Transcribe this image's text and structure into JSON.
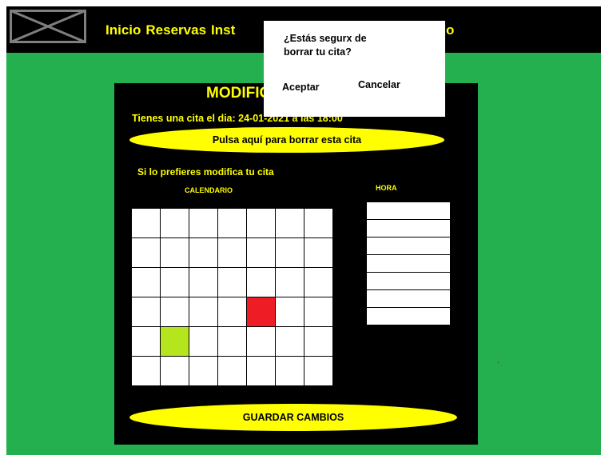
{
  "colors": {
    "background": "#24b04e",
    "bar": "#000000",
    "accent": "#ffff00",
    "selected_day": "#ee1c24",
    "highlighted_day": "#b5e61d"
  },
  "nav": {
    "items": [
      "Inicio",
      "Reservas",
      "Inst"
    ],
    "trailing": "o"
  },
  "logo": {
    "icon": "image-placeholder-icon"
  },
  "panel": {
    "title": "MODIFIC",
    "appointment_text": "Tienes una cita  el dia: 24-01-2021 a las 18:00",
    "delete_button": "Pulsa aquí para borrar esta cita",
    "prefer_text": "Si lo prefieres modifica tu cita",
    "calendar_label": "CALENDARIO",
    "hour_label": "HORA",
    "save_button": "GUARDAR CAMBIOS"
  },
  "calendar": {
    "rows": 6,
    "cols": 7,
    "red_cell": [
      3,
      4
    ],
    "green_cell": [
      4,
      1
    ]
  },
  "hours": {
    "slots": 7
  },
  "dialog": {
    "message": "¿Estás segurx de borrar tu cita?",
    "accept": "Aceptar",
    "cancel": "Cancelar"
  }
}
